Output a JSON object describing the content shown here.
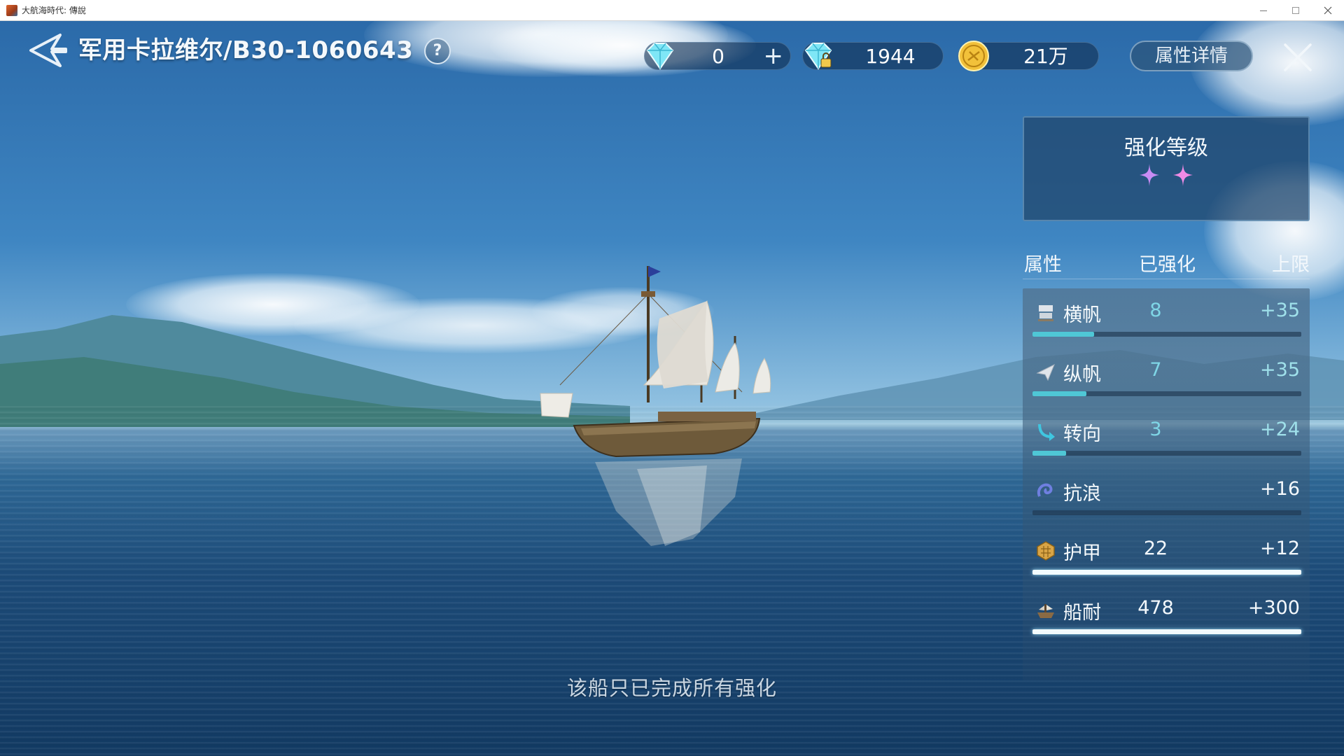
{
  "window": {
    "title": "大航海時代: 傳說"
  },
  "header": {
    "ship_name": "军用卡拉维尔/B30-1060643",
    "help_label": "?",
    "attr_detail_label": "属性详情"
  },
  "currencies": [
    {
      "icon": "diamond-icon",
      "value": "0",
      "has_plus": true,
      "plus_label": "+"
    },
    {
      "icon": "bound-diamond-icon",
      "value": "1944"
    },
    {
      "icon": "gold-coin-icon",
      "value": "21万"
    }
  ],
  "enhance": {
    "title": "强化等级",
    "stars": 2,
    "star_colors": [
      "#c98cf5",
      "#f08be6"
    ]
  },
  "attributes": {
    "header": {
      "attr": "属性",
      "enhanced": "已强化",
      "limit": "上限"
    },
    "rows": [
      {
        "icon": "square-sail-icon",
        "name": "横帆",
        "enhanced": "8",
        "limit": "+35",
        "progress": 0.23
      },
      {
        "icon": "lateen-sail-icon",
        "name": "纵帆",
        "enhanced": "7",
        "limit": "+35",
        "progress": 0.2
      },
      {
        "icon": "turning-icon",
        "name": "转向",
        "enhanced": "3",
        "limit": "+24",
        "progress": 0.125
      },
      {
        "icon": "wave-resist-icon",
        "name": "抗浪",
        "enhanced": "",
        "limit": "+16",
        "progress": 0
      },
      {
        "icon": "armor-icon",
        "name": "护甲",
        "enhanced": "22",
        "limit": "+12",
        "progress": 1
      },
      {
        "icon": "durability-icon",
        "name": "船耐",
        "enhanced": "478",
        "limit": "+300",
        "progress": 1
      }
    ]
  },
  "message": "该船只已完成所有强化",
  "colors": {
    "accent_cyan": "#4fc7d6",
    "panel_bg": "#20466c"
  }
}
